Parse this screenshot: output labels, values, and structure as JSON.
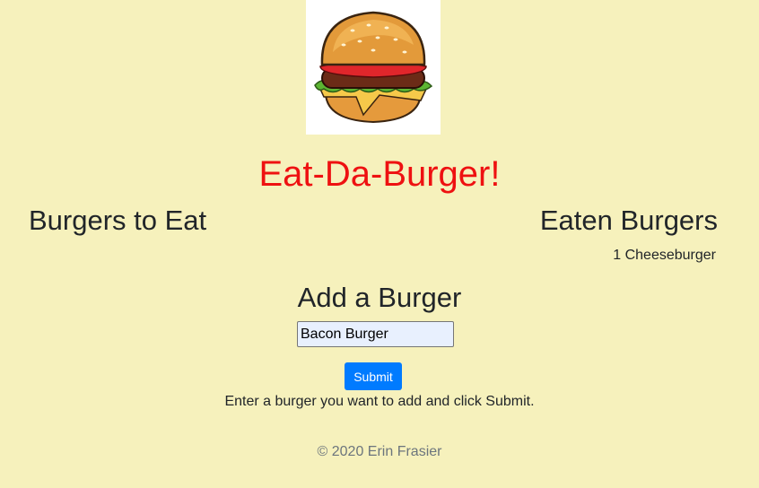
{
  "header": {
    "logo": "burger-logo",
    "title": "Eat-Da-Burger!"
  },
  "columns": {
    "to_eat": {
      "heading": "Burgers to Eat",
      "items": []
    },
    "eaten": {
      "heading": "Eaten Burgers",
      "items": [
        "1 Cheeseburger"
      ]
    }
  },
  "form": {
    "heading": "Add a Burger",
    "input_value": "Bacon Burger",
    "submit_label": "Submit",
    "instructions": "Enter a burger you want to add and click Submit."
  },
  "footer": {
    "text": "© 2020 Erin Frasier"
  },
  "colors": {
    "background": "#f6f1bc",
    "title": "#ee1111",
    "button": "#007bff"
  }
}
